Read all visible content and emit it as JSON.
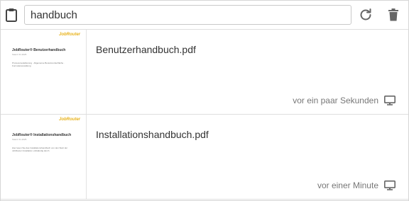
{
  "search": {
    "value": "handbuch"
  },
  "files": [
    {
      "name": "Benutzerhandbuch.pdf",
      "time": "vor ein paar Sekunden",
      "thumb": {
        "brand": "JobRouter",
        "title": "JobRouter® Benutzerhandbuch",
        "subtitle": "Stand: 01.2025",
        "desc": "Prozessmodellierung · Allgemeine Benutzeroberfläche · Formularverwaltung"
      }
    },
    {
      "name": "Installationshandbuch.pdf",
      "time": "vor einer Minute",
      "thumb": {
        "brand": "JobRouter",
        "title": "JobRouter® Installationshandbuch",
        "subtitle": "Stand: 01.2025",
        "desc": "Hier lesen Sie das Installationshandbuch von den Start der JobRouter Installation vollständig durch"
      }
    }
  ]
}
